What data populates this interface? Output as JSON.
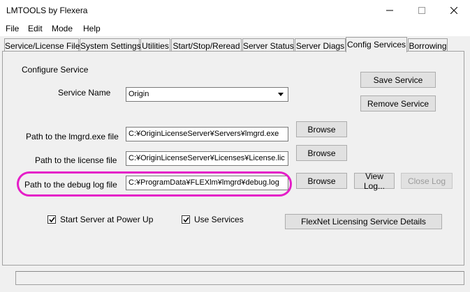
{
  "window": {
    "title": "LMTOOLS by Flexera",
    "minimize_icon": "minimize-icon",
    "maximize_icon": "maximize-icon",
    "close_icon": "close-icon"
  },
  "menu": [
    "File",
    "Edit",
    "Mode",
    "Help"
  ],
  "tabs": [
    "Service/License File",
    "System Settings",
    "Utilities",
    "Start/Stop/Reread",
    "Server Status",
    "Server Diags",
    "Config Services",
    "Borrowing"
  ],
  "active_tab": "Config Services",
  "config": {
    "section_label": "Configure Service",
    "service_name_label": "Service Name",
    "service_name_value": "Origin",
    "lmgrd_label": "Path to the lmgrd.exe file",
    "lmgrd_value": "C:¥OriginLicenseServer¥Servers¥lmgrd.exe",
    "license_label": "Path to the license file",
    "license_value": "C:¥OriginLicenseServer¥Licenses¥License.lic",
    "debug_label": "Path to the debug log file",
    "debug_value": "C:¥ProgramData¥FLEXlm¥lmgrd¥debug.log",
    "browse_label": "Browse",
    "view_log_label": "View Log...",
    "close_log_label": "Close Log",
    "save_service_label": "Save Service",
    "remove_service_label": "Remove Service",
    "start_at_power_up_label": "Start Server at Power Up",
    "start_at_power_up_checked": true,
    "use_services_label": "Use Services",
    "use_services_checked": true,
    "flexnet_details_label": "FlexNet Licensing Service Details"
  },
  "colors": {
    "highlight_outline": "#e51ec8",
    "window_bg": "#f0f0f0"
  }
}
